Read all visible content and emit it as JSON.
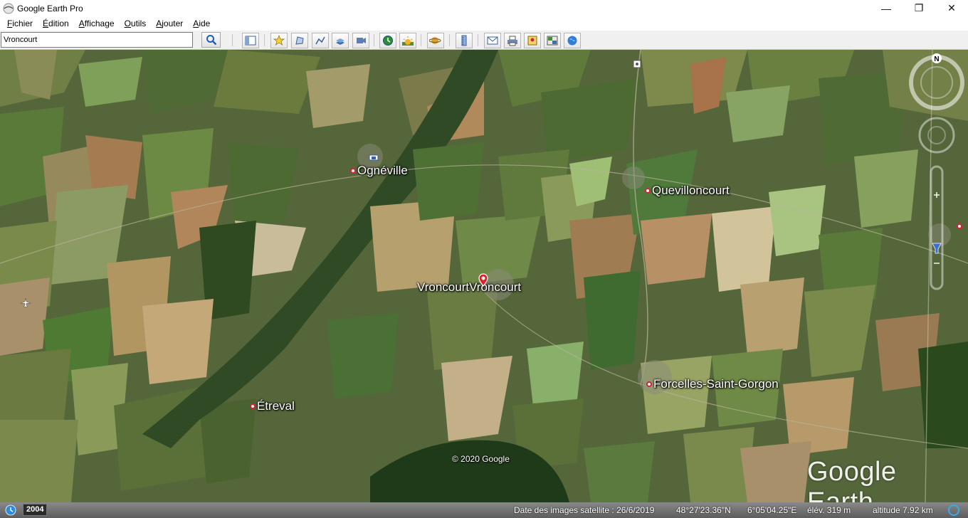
{
  "window": {
    "title": "Google Earth Pro",
    "minimize_label": "—",
    "maximize_label": "❐",
    "close_label": "✕"
  },
  "menu": {
    "items": [
      "Fichier",
      "Édition",
      "Affichage",
      "Outils",
      "Ajouter",
      "Aide"
    ]
  },
  "search": {
    "value": "Vroncourt"
  },
  "toolbar": {
    "buttons": [
      "sidebar-icon",
      "placemark-icon",
      "polygon-icon",
      "path-icon",
      "image-overlay-icon",
      "record-tour-icon",
      "historical-imagery-icon",
      "sunlight-icon",
      "planets-icon",
      "ruler-icon",
      "email-icon",
      "print-icon",
      "save-image-icon",
      "google-maps-icon",
      "earth-icon"
    ]
  },
  "map": {
    "places": [
      {
        "name": "Ognéville"
      },
      {
        "name": "Quevilloncourt"
      },
      {
        "name": "Vroncourt"
      },
      {
        "name": "Vroncourt"
      },
      {
        "name": "Forcelles-Saint-Gorgon"
      },
      {
        "name": "Étreval"
      }
    ],
    "copyright": "© 2020 Google",
    "logo": "Google Earth",
    "compass_north": "N"
  },
  "status": {
    "year": "2004",
    "imagery_date": "Date des images satellite : 26/6/2019",
    "latitude": "48°27'23.36\"N",
    "longitude": "6°05'04.25\"E",
    "elevation": "élév.  319 m",
    "altitude": "altitude   7.92 km"
  }
}
